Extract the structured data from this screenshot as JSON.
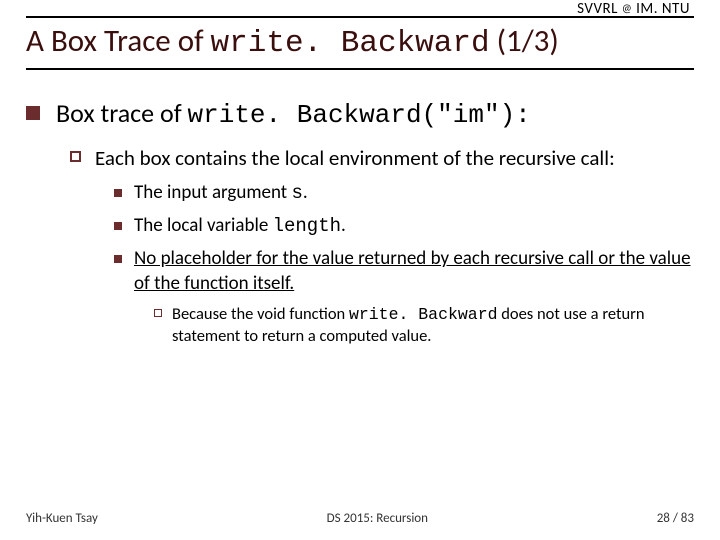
{
  "affiliation": {
    "left": "SVVRL",
    "at": "@",
    "right": "IM. NTU"
  },
  "title": {
    "pre": "A Box Trace of ",
    "code": "write. Backward",
    "post": " (1/3)"
  },
  "level1": {
    "pre": "Box trace of ",
    "code": "write. Backward(\"im\"):"
  },
  "level2": {
    "text": "Each box contains the local environment of the recursive call:"
  },
  "level3": [
    {
      "pre": "The input argument ",
      "code": "s",
      "post": "."
    },
    {
      "pre": "The local variable ",
      "code": "length",
      "post": "."
    },
    {
      "underlined": "No placeholder for the value returned by each recursive call or the value of the function itself."
    }
  ],
  "level4": {
    "pre": "Because the void function ",
    "code": "write. Backward",
    "post": " does not use a return statement to return a computed value."
  },
  "footer": {
    "left": "Yih-Kuen Tsay",
    "center": "DS 2015: Recursion",
    "right": "28 / 83"
  }
}
